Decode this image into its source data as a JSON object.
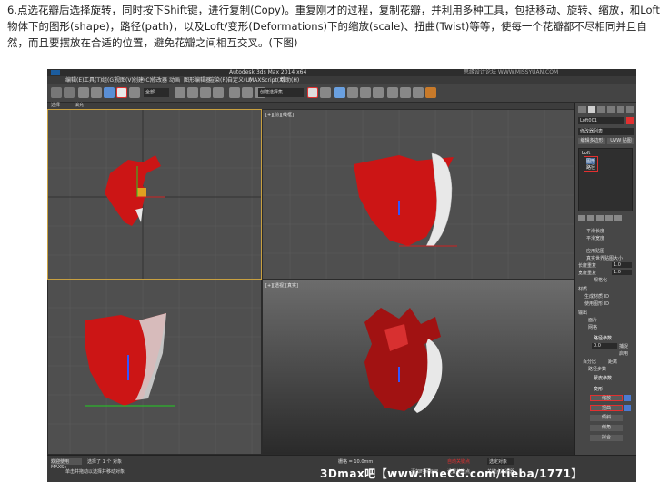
{
  "instruction_text": "6.点选花瓣后选择旋转，同时按下Shift键，进行复制(Copy)。重复刚才的过程，复制花瓣，并利用多种工具，包括移动、旋转、缩放，和Loft物体下的图形(shape)，路径(path)，以及Loft/变形(Deformations)下的缩放(scale)、扭曲(Twist)等等，使每一个花瓣都不尽相同并且自然，而且要摆放在合适的位置，避免花瓣之间相互交叉。(下图)",
  "app": {
    "title": "Autodesk 3ds Max 2014 x64",
    "menu": [
      "编辑(E)",
      "工具(T)",
      "组(G)",
      "视图(V)",
      "创建(C)",
      "修改器",
      "动画",
      "图形编辑器",
      "渲染(R)",
      "自定义(U)",
      "MAXScript(X)",
      "帮助(H)"
    ],
    "selection_dropdown": "全部",
    "named_selection": "创建选择集",
    "subtoolbar": [
      "选择",
      "填充"
    ]
  },
  "viewports": {
    "top_left_label": "",
    "top_right_label": "[+][前][线框]",
    "bottom_left_label": "",
    "bottom_right_label": "[+][透视][真实]"
  },
  "command_panel": {
    "object_name": "Loft001",
    "modifier_list": "修改器列表",
    "buttons": [
      "编辑多边形",
      "UVW 贴图"
    ],
    "stack": [
      "Loft",
      "图形",
      "路径"
    ],
    "rollout_deformations": "变形",
    "deform_buttons": [
      "缩放",
      "扭曲",
      "倾斜",
      "倒角",
      "拟合"
    ],
    "rollout_skin": "蒙皮参数",
    "rollout_path": "路径参数",
    "path_value": "0.0",
    "labels": [
      "平滑长度",
      "平滑宽度",
      "应用贴图",
      "真实世界贴图大小",
      "长度重复",
      "宽度重复",
      "规格化",
      "材质",
      "生成材质 ID",
      "使用图形 ID",
      "输出",
      "面片",
      "网格",
      "捕捉",
      "启用",
      "百分比",
      "距离",
      "路径步数"
    ],
    "length_repeat": "1.0",
    "width_repeat": "1.0"
  },
  "status": {
    "selected": "选择了 1 个 对象",
    "hint": "单击并拖动以选择并移动对象",
    "grid": "栅格 = 10.0mm",
    "auto_key": "自动关键点",
    "set_key": "设置关键点",
    "key_filter": "关键点过滤器",
    "add_time_tag": "添加时间标记",
    "selected_obj": "选定对象",
    "zoom": "0",
    "welcome": "欢迎使用 MAXSc"
  },
  "watermarks": {
    "top_right": "思缘设计论坛 WWW.MISSYUAN.COM",
    "bottom": "3Dmax吧【www.lineCG.com/tieba/1771】"
  },
  "colors": {
    "highlight_red": "#e23030",
    "petal_red": "#cc1515",
    "active_viewport_border": "#c8a040"
  }
}
